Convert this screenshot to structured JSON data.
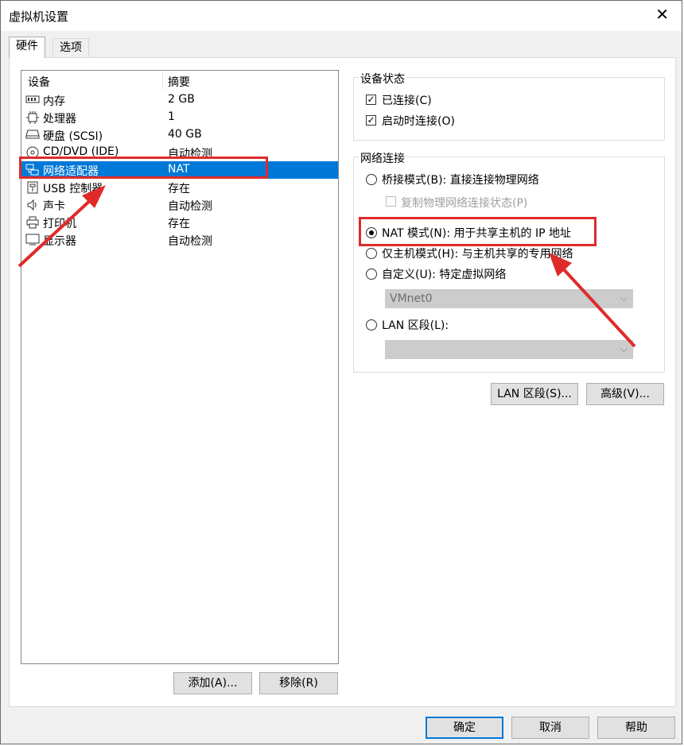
{
  "window": {
    "title": "虚拟机设置",
    "close_glyph": "✕"
  },
  "tabs": [
    {
      "label": "硬件",
      "active": true
    },
    {
      "label": "选项",
      "active": false
    }
  ],
  "device_list": {
    "columns": [
      "设备",
      "摘要"
    ],
    "rows": [
      {
        "icon": "memory-icon",
        "name": "内存",
        "summary": "2 GB"
      },
      {
        "icon": "processor-icon",
        "name": "处理器",
        "summary": "1"
      },
      {
        "icon": "hard-disk-icon",
        "name": "硬盘 (SCSI)",
        "summary": "40 GB"
      },
      {
        "icon": "cd-dvd-icon",
        "name": "CD/DVD (IDE)",
        "summary": "自动检测"
      },
      {
        "icon": "network-adapter-icon",
        "name": "网络适配器",
        "summary": "NAT",
        "selected": true
      },
      {
        "icon": "usb-icon",
        "name": "USB 控制器",
        "summary": "存在"
      },
      {
        "icon": "sound-icon",
        "name": "声卡",
        "summary": "自动检测"
      },
      {
        "icon": "printer-icon",
        "name": "打印机",
        "summary": "存在"
      },
      {
        "icon": "monitor-icon",
        "name": "显示器",
        "summary": "自动检测"
      }
    ],
    "add_button": "添加(A)...",
    "remove_button": "移除(R)"
  },
  "device_status": {
    "title": "设备状态",
    "connected": {
      "label": "已连接(C)",
      "checked": true
    },
    "connect_at_power_on": {
      "label": "启动时连接(O)",
      "checked": true
    }
  },
  "network_connection": {
    "title": "网络连接",
    "bridged": {
      "label": "桥接模式(B): 直接连接物理网络",
      "selected": false
    },
    "replicate": {
      "label": "复制物理网络连接状态(P)",
      "checked": false,
      "disabled": true
    },
    "nat": {
      "label": "NAT 模式(N): 用于共享主机的 IP 地址",
      "selected": true
    },
    "host_only": {
      "label": "仅主机模式(H): 与主机共享的专用网络",
      "selected": false
    },
    "custom": {
      "label": "自定义(U): 特定虚拟网络",
      "selected": false
    },
    "custom_value": "VMnet0",
    "lan_segment": {
      "label": "LAN 区段(L):",
      "selected": false
    },
    "lan_value": ""
  },
  "right_buttons": {
    "lan_segments": "LAN 区段(S)...",
    "advanced": "高级(V)..."
  },
  "footer": {
    "ok": "确定",
    "cancel": "取消",
    "help": "帮助"
  },
  "colors": {
    "selection": "#0078d7",
    "annotation": "#e02a2a"
  }
}
